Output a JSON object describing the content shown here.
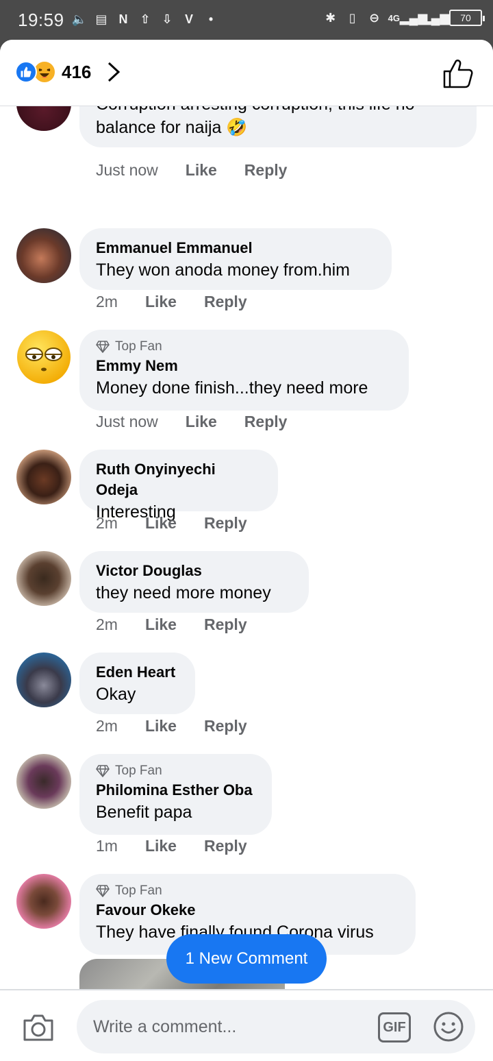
{
  "status_bar": {
    "time": "19:59",
    "battery": "70",
    "network": "4G"
  },
  "header": {
    "reaction_count": "416"
  },
  "comments": [
    {
      "name": "",
      "text_line1": "Corruption arresting corruption, this life no",
      "text_line2": "balance for naija",
      "emoji": "🤣",
      "time": "Just now",
      "like": "Like",
      "reply": "Reply"
    },
    {
      "name": "Emmanuel Emmanuel",
      "text": "They won anoda money from.him",
      "time": "2m",
      "like": "Like",
      "reply": "Reply"
    },
    {
      "badge": "Top Fan",
      "name": "Emmy Nem",
      "text": "Money done finish...they need more",
      "time": "Just now",
      "like": "Like",
      "reply": "Reply"
    },
    {
      "name": "Ruth Onyinyechi Odeja",
      "text": "Interesting",
      "time": "2m",
      "like": "Like",
      "reply": "Reply"
    },
    {
      "name": "Victor Douglas",
      "text": "they need more money",
      "time": "2m",
      "like": "Like",
      "reply": "Reply"
    },
    {
      "name": "Eden Heart",
      "text": "Okay",
      "time": "2m",
      "like": "Like",
      "reply": "Reply"
    },
    {
      "badge": "Top Fan",
      "name": "Philomina Esther Oba",
      "text": "Benefit papa",
      "time": "1m",
      "like": "Like",
      "reply": "Reply"
    },
    {
      "badge": "Top Fan",
      "name": "Favour Okeke",
      "text": "They have finally found Corona virus"
    }
  ],
  "new_comment_button": "1 New Comment",
  "composer": {
    "placeholder": "Write a comment...",
    "gif_label": "GIF"
  },
  "colors": {
    "accent": "#1877f2",
    "bubble": "#f0f2f5",
    "muted_text": "#65676b"
  }
}
